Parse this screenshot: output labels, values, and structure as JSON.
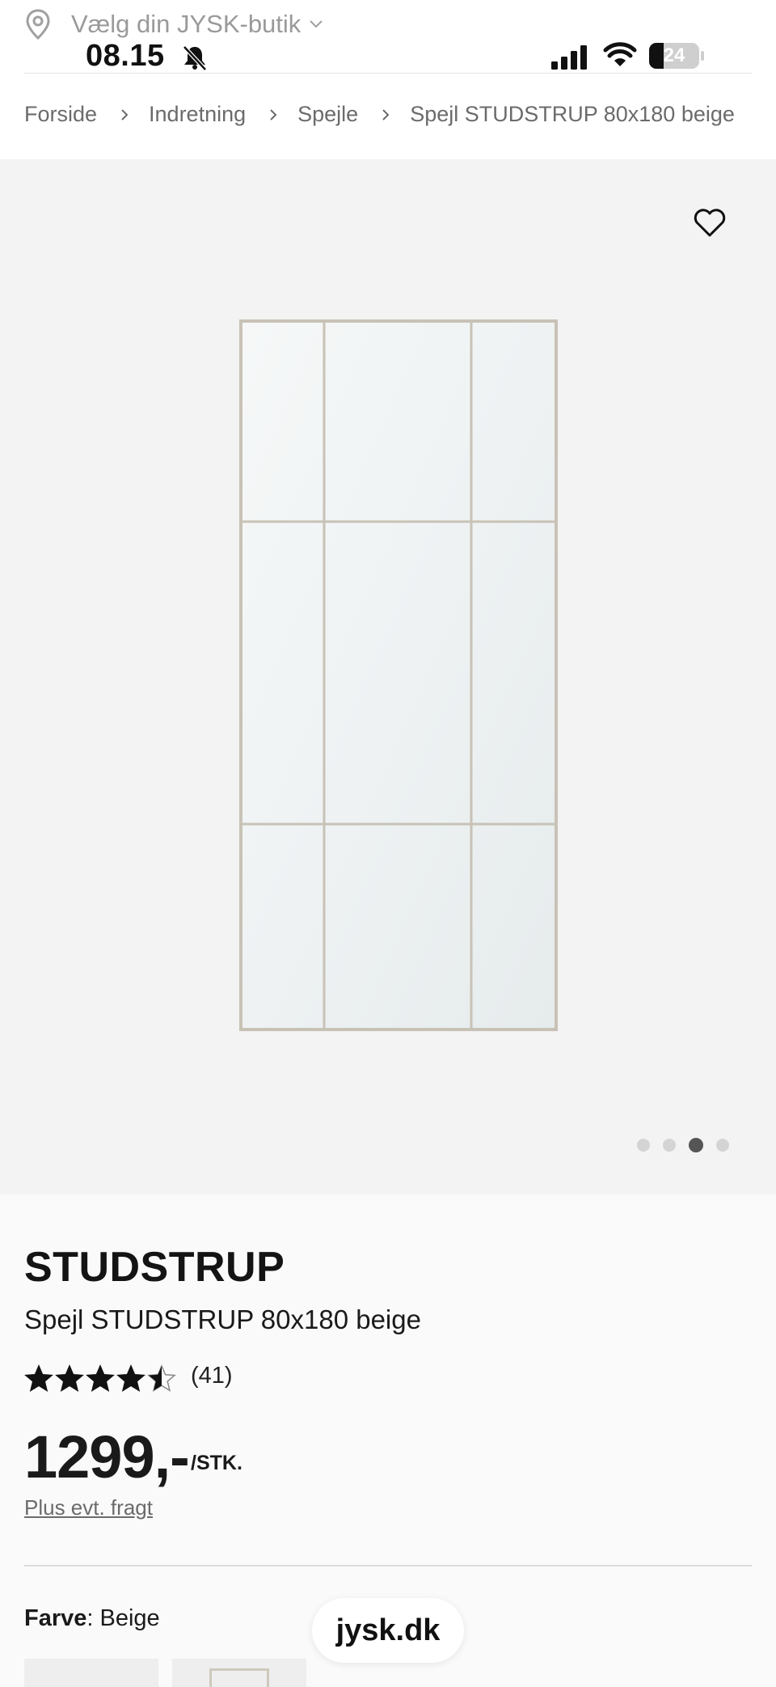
{
  "status_bar": {
    "store_prompt": "Vælg din JYSK-butik",
    "time": "08.15",
    "battery": "24"
  },
  "breadcrumb": [
    "Forside",
    "Indretning",
    "Spejle",
    "Spejl STUDSTRUP 80x180 beige"
  ],
  "gallery": {
    "page_count": 4,
    "active_page": 3
  },
  "product": {
    "brand": "STUDSTRUP",
    "name": "Spejl STUDSTRUP 80x180 beige",
    "rating": 4.5,
    "rating_max": 5,
    "review_count": "(41)",
    "price": "1299,-",
    "price_unit": "/STK.",
    "freight_link": "Plus evt. fragt",
    "color_label": "Farve",
    "color_value": ": Beige"
  },
  "site": "jysk.dk",
  "icons": [
    "location-pin-icon",
    "chevron-down-icon",
    "bell-muted-icon",
    "signal-icon",
    "wifi-icon",
    "battery-icon",
    "chevron-right-icon",
    "heart-icon",
    "star-icon"
  ],
  "colors": {
    "gallery_bg": "#f3f3f3",
    "active_dot": "#555555",
    "frame": "#cfc9bd"
  }
}
